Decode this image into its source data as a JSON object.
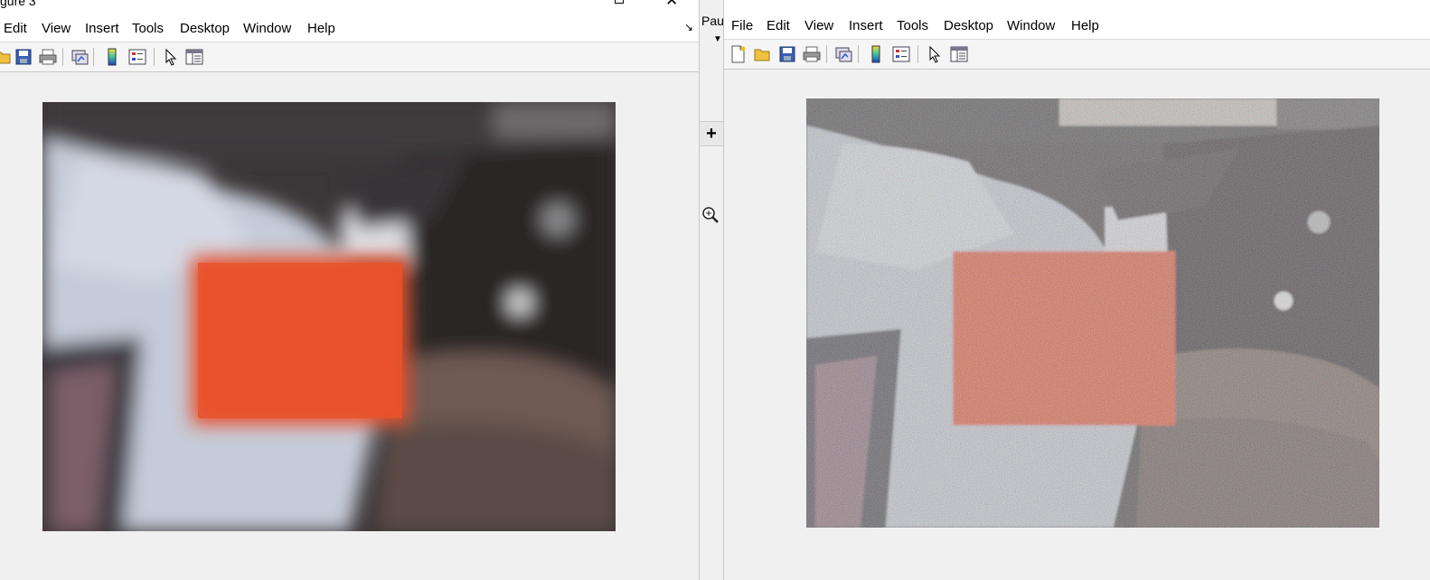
{
  "left_window": {
    "title_fragment": "gure 3",
    "menus": [
      "Edit",
      "View",
      "Insert",
      "Tools",
      "Desktop",
      "Window",
      "Help"
    ],
    "dock_icon": "dock-arrow-icon",
    "toolbar": [
      "open-folder-icon",
      "save-icon",
      "print-icon",
      "|",
      "link-plot-icon",
      "|",
      "colorbar-icon",
      "legend-icon",
      "|",
      "pointer-icon",
      "property-inspector-icon"
    ]
  },
  "middle_strip": {
    "label": "Paus",
    "buttons": [
      "dropdown-arrow-icon",
      "plus-icon",
      "zoom-in-icon"
    ]
  },
  "right_window": {
    "menus": [
      "File",
      "Edit",
      "View",
      "Insert",
      "Tools",
      "Desktop",
      "Window",
      "Help"
    ],
    "toolbar": [
      "new-figure-icon",
      "open-folder-icon",
      "save-icon",
      "print-icon",
      "|",
      "link-plot-icon",
      "|",
      "colorbar-icon",
      "legend-icon",
      "|",
      "pointer-icon",
      "property-inspector-icon"
    ]
  },
  "images": {
    "left": "blurred webcam frame showing an orange card",
    "right": "noisy webcam frame showing an orange card"
  },
  "colors": {
    "card": "#e8502c",
    "shirt": "#c8ccd8",
    "dark_background": "#2a2428",
    "skin": "#6e5a52"
  }
}
